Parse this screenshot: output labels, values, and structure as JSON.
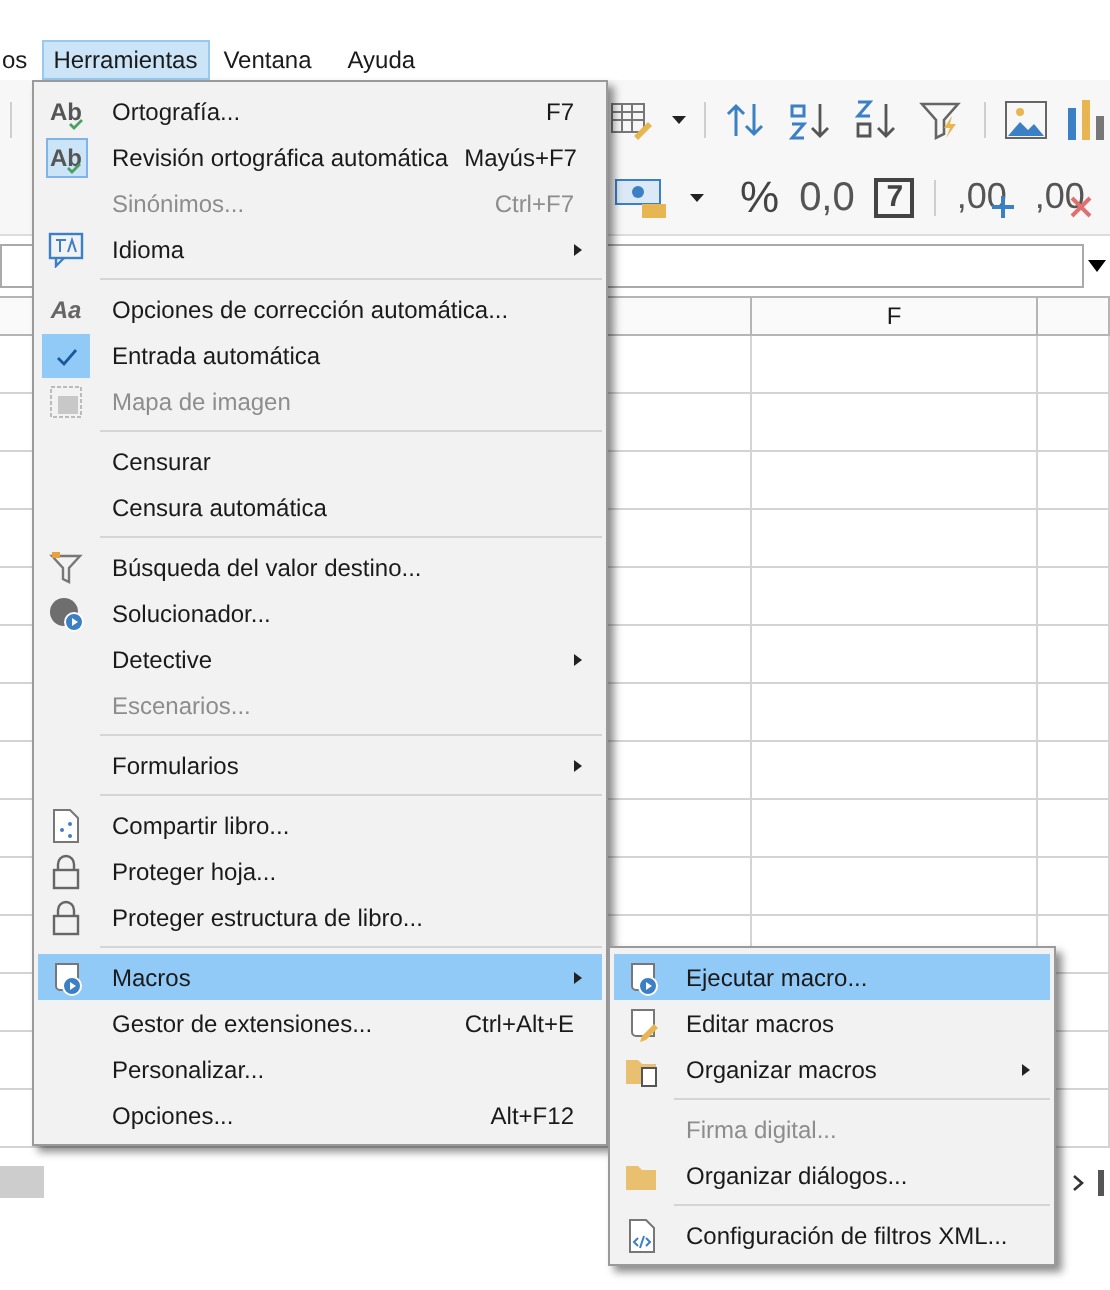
{
  "menubar": [
    {
      "label": "os",
      "selected": false
    },
    {
      "label": "Herramientas",
      "selected": true
    },
    {
      "label": "Ventana",
      "selected": false
    },
    {
      "label": "Ayuda",
      "selected": false
    }
  ],
  "format_toolbar": [
    {
      "kind": "percent",
      "text": "%"
    },
    {
      "kind": "number",
      "text": "0,0"
    },
    {
      "kind": "date",
      "text": "7"
    },
    {
      "kind": "add-decimal",
      "text": ",00"
    },
    {
      "kind": "delete-decimal",
      "text": ",00"
    }
  ],
  "column_headers": [
    "F"
  ],
  "menu": [
    {
      "kind": "item",
      "icon_text": "Ab",
      "label": "Ortografía...",
      "shortcut": "F7",
      "checked": false,
      "disabled": false,
      "selected": false,
      "submenu": false
    },
    {
      "kind": "item",
      "icon_text": "Ab",
      "label": "Revisión ortográfica automática",
      "shortcut": "Mayús+F7",
      "checked": true,
      "disabled": false,
      "selected": false,
      "submenu": false
    },
    {
      "kind": "item",
      "label": "Sinónimos...",
      "shortcut": "Ctrl+F7",
      "checked": false,
      "disabled": true,
      "selected": false,
      "submenu": false
    },
    {
      "kind": "item",
      "label": "Idioma",
      "checked": false,
      "disabled": false,
      "selected": false,
      "submenu": true
    },
    {
      "kind": "separator"
    },
    {
      "kind": "item",
      "icon_text": "Aa",
      "label": "Opciones de corrección automática...",
      "checked": false,
      "disabled": false,
      "selected": false,
      "submenu": false
    },
    {
      "kind": "item",
      "label": "Entrada automática",
      "checked": true,
      "disabled": false,
      "selected": false,
      "submenu": false
    },
    {
      "kind": "item",
      "label": "Mapa de imagen",
      "checked": false,
      "disabled": true,
      "selected": false,
      "submenu": false
    },
    {
      "kind": "separator"
    },
    {
      "kind": "item",
      "label": "Censurar",
      "checked": false,
      "disabled": false,
      "selected": false,
      "submenu": false
    },
    {
      "kind": "item",
      "label": "Censura automática",
      "checked": false,
      "disabled": false,
      "selected": false,
      "submenu": false
    },
    {
      "kind": "separator"
    },
    {
      "kind": "item",
      "label": "Búsqueda del valor destino...",
      "checked": false,
      "disabled": false,
      "selected": false,
      "submenu": false
    },
    {
      "kind": "item",
      "label": "Solucionador...",
      "checked": false,
      "disabled": false,
      "selected": false,
      "submenu": false
    },
    {
      "kind": "item",
      "label": "Detective",
      "checked": false,
      "disabled": false,
      "selected": false,
      "submenu": true
    },
    {
      "kind": "item",
      "label": "Escenarios...",
      "checked": false,
      "disabled": true,
      "selected": false,
      "submenu": false
    },
    {
      "kind": "separator"
    },
    {
      "kind": "item",
      "label": "Formularios",
      "checked": false,
      "disabled": false,
      "selected": false,
      "submenu": true
    },
    {
      "kind": "separator"
    },
    {
      "kind": "item",
      "label": "Compartir libro...",
      "checked": false,
      "disabled": false,
      "selected": false,
      "submenu": false
    },
    {
      "kind": "item",
      "label": "Proteger hoja...",
      "checked": false,
      "disabled": false,
      "selected": false,
      "submenu": false
    },
    {
      "kind": "item",
      "label": "Proteger estructura de libro...",
      "checked": false,
      "disabled": false,
      "selected": false,
      "submenu": false
    },
    {
      "kind": "separator"
    },
    {
      "kind": "item",
      "label": "Macros",
      "checked": false,
      "disabled": false,
      "selected": true,
      "submenu": true
    },
    {
      "kind": "item",
      "label": "Gestor de extensiones...",
      "shortcut": "Ctrl+Alt+E",
      "checked": false,
      "disabled": false,
      "selected": false,
      "submenu": false
    },
    {
      "kind": "item",
      "label": "Personalizar...",
      "checked": false,
      "disabled": false,
      "selected": false,
      "submenu": false
    },
    {
      "kind": "item",
      "label": "Opciones...",
      "shortcut": "Alt+F12",
      "checked": false,
      "disabled": false,
      "selected": false,
      "submenu": false
    }
  ],
  "macros_submenu": [
    {
      "kind": "item",
      "label": "Ejecutar macro...",
      "disabled": false,
      "selected": true,
      "submenu": false
    },
    {
      "kind": "item",
      "label": "Editar macros",
      "disabled": false,
      "selected": false,
      "submenu": false
    },
    {
      "kind": "item",
      "label": "Organizar macros",
      "disabled": false,
      "selected": false,
      "submenu": true
    },
    {
      "kind": "separator"
    },
    {
      "kind": "item",
      "label": "Firma digital...",
      "disabled": true,
      "selected": false,
      "submenu": false
    },
    {
      "kind": "item",
      "label": "Organizar diálogos...",
      "disabled": false,
      "selected": false,
      "submenu": false
    },
    {
      "kind": "separator"
    },
    {
      "kind": "item",
      "label": "Configuración de filtros XML...",
      "disabled": false,
      "selected": false,
      "submenu": false
    }
  ]
}
